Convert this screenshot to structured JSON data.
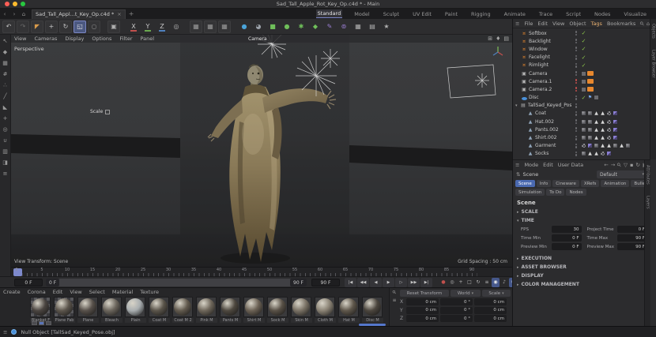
{
  "window": {
    "title": "Sad_Tall_Apple_Rot_Key_Op.c4d * - Main"
  },
  "nav": {
    "back": "‹",
    "forward": "›",
    "home": "⌂",
    "tab_label": "Sad_Tall_Appl...t_Key_Op.c4d *",
    "tab_close": "×",
    "tab_add": "+"
  },
  "layouts": {
    "active": "Standard",
    "items": [
      "Standard",
      "Model",
      "Sculpt",
      "UV Edit",
      "Paint",
      "Rigging",
      "Animate",
      "Trace",
      "Script",
      "Nodes",
      "Visualize"
    ]
  },
  "toolbar": {
    "icons": [
      {
        "name": "undo-icon",
        "glyph": "↶",
        "color": "#c0c0c0"
      },
      {
        "name": "redo-icon",
        "glyph": "↷",
        "color": "#6a6a6a"
      },
      {
        "name": "live-selection-icon",
        "glyph": "◤",
        "color": "#d89a4a"
      },
      {
        "name": "move-tool-icon",
        "glyph": "+",
        "color": "#c8c8c8"
      },
      {
        "name": "rotate-tool-icon",
        "glyph": "↻",
        "color": "#c8c8c8"
      },
      {
        "name": "scale-tool-icon",
        "glyph": "◱",
        "color": "#e8e8e8",
        "active": true
      },
      {
        "name": "last-tool-icon",
        "glyph": "○",
        "color": "#8a8a8a"
      },
      {
        "name": "sep",
        "sep": true
      },
      {
        "name": "workplane-icon",
        "glyph": "▣",
        "color": "#b0b0b0"
      },
      {
        "name": "sep",
        "sep": true
      },
      {
        "name": "x-axis-lock",
        "glyph": "X",
        "color": "#c8c8c8",
        "underline": "#c0504d",
        "noboxed": true
      },
      {
        "name": "y-axis-lock",
        "glyph": "Y",
        "color": "#c8c8c8",
        "underline": "#6aa84f",
        "noboxed": true
      },
      {
        "name": "z-axis-lock",
        "glyph": "Z",
        "color": "#c8c8c8",
        "underline": "#4f81bd",
        "noboxed": true
      },
      {
        "name": "coord-system-icon",
        "glyph": "◎",
        "color": "#b0b0b0",
        "noboxed": true
      },
      {
        "name": "sep",
        "sep": true
      },
      {
        "name": "keyframe-bar-1-icon",
        "glyph": "▦",
        "color": "#9a9a9a"
      },
      {
        "name": "keyframe-bar-2-icon",
        "glyph": "▦",
        "color": "#9a9a9a"
      },
      {
        "name": "keyframe-bar-3-icon",
        "glyph": "▦",
        "color": "#9a9a9a"
      },
      {
        "name": "sep",
        "sep": true
      },
      {
        "name": "render-view-icon",
        "glyph": "●",
        "color": "#4aa3d8",
        "noboxed": true
      },
      {
        "name": "render-settings-icon",
        "glyph": "◕",
        "color": "#9aa0a8",
        "noboxed": true
      },
      {
        "name": "add-cube-icon",
        "glyph": "■",
        "color": "#6fbf5a",
        "noboxed": true
      },
      {
        "name": "add-sphere-icon",
        "glyph": "●",
        "color": "#6fbf5a",
        "noboxed": true
      },
      {
        "name": "generators-icon",
        "glyph": "✱",
        "color": "#6fbf5a",
        "noboxed": true
      },
      {
        "name": "deformers-icon",
        "glyph": "◆",
        "color": "#6fbf5a",
        "noboxed": true
      },
      {
        "name": "spline-pen-icon",
        "glyph": "✎",
        "color": "#9b7fd4",
        "noboxed": true
      },
      {
        "name": "mograph-icon",
        "glyph": "⊚",
        "color": "#9b7fd4",
        "noboxed": true
      },
      {
        "name": "array-icon",
        "glyph": "▦",
        "color": "#b0b0b0",
        "noboxed": true
      },
      {
        "name": "folder-icon",
        "glyph": "▤",
        "color": "#b0b0b0",
        "noboxed": true
      },
      {
        "name": "magic-icon",
        "glyph": "★",
        "color": "#b0b0b0",
        "noboxed": true
      }
    ]
  },
  "left_palette": {
    "icons": [
      {
        "name": "make-editable-icon",
        "glyph": "↖"
      },
      {
        "name": "model-mode-icon",
        "glyph": "◆"
      },
      {
        "name": "texture-mode-icon",
        "glyph": "▦"
      },
      {
        "name": "workplane-mode-icon",
        "glyph": "#"
      },
      {
        "name": "points-mode-icon",
        "glyph": "∴"
      },
      {
        "name": "edges-mode-icon",
        "glyph": "╱"
      },
      {
        "name": "polygons-mode-icon",
        "glyph": "◣"
      },
      {
        "name": "tweak-mode-icon",
        "glyph": "+"
      },
      {
        "name": "axis-mode-icon",
        "glyph": "◎"
      },
      {
        "name": "snap-icon",
        "glyph": "∪"
      },
      {
        "name": "quantize-icon",
        "glyph": "▥"
      },
      {
        "name": "workplane-lock-icon",
        "glyph": "◨"
      },
      {
        "name": "filter-list-icon",
        "glyph": "≡"
      }
    ]
  },
  "viewport": {
    "menus": [
      "View",
      "Cameras",
      "Display",
      "Options",
      "Filter",
      "Panel"
    ],
    "view_label": "Perspective",
    "camera_label": "Camera",
    "hud_scale_label": "Scale",
    "transform_label": "View Transform: Scene",
    "grid_label": "Grid Spacing : 50 cm",
    "corner_icons": [
      {
        "name": "grid-toggle-icon",
        "glyph": "⊞"
      },
      {
        "name": "render-safe-icon",
        "glyph": "♦"
      },
      {
        "name": "view-layout-icon",
        "glyph": "▤"
      }
    ]
  },
  "object_manager": {
    "menus": [
      "File",
      "Edit",
      "View",
      "Object",
      "Tags",
      "Bookmarks"
    ],
    "active_menu": "Tags",
    "header_icons": [
      {
        "name": "search-icon",
        "glyph": "⚲"
      },
      {
        "name": "home-icon",
        "glyph": "⌂"
      },
      {
        "name": "filter-icon",
        "glyph": "▽"
      },
      {
        "name": "new-panel-icon",
        "glyph": "▣"
      }
    ],
    "objects": [
      {
        "name": "Softbox",
        "icon": "light",
        "dots": "gray",
        "tags": [
          "check"
        ]
      },
      {
        "name": "Backlight",
        "icon": "light",
        "dots": "gray",
        "tags": [
          "check"
        ]
      },
      {
        "name": "Window",
        "icon": "light",
        "dots": "gray",
        "tags": [
          "check"
        ]
      },
      {
        "name": "Facelight",
        "icon": "light",
        "dots": "gray",
        "tags": [
          "check"
        ]
      },
      {
        "name": "Rimlight",
        "icon": "light",
        "dots": "gray",
        "tags": [
          "check"
        ]
      },
      {
        "name": "Camera",
        "icon": "camera",
        "dots": "gray",
        "tags": [
          "comp",
          "cam"
        ]
      },
      {
        "name": "Camera.1",
        "icon": "camera",
        "dots": "red",
        "tags": [
          "comp",
          "cam"
        ]
      },
      {
        "name": "Camera.2",
        "icon": "camera",
        "dots": "red",
        "tags": [
          "comp",
          "cam"
        ]
      },
      {
        "name": "Disc",
        "icon": "disc",
        "dots": "gray",
        "tags": [
          "check",
          "display",
          "comp"
        ]
      },
      {
        "name": "TallSad_Keyed_Pose.obj",
        "icon": "file",
        "dots": "gray",
        "caret": "▾",
        "tags": []
      },
      {
        "name": "Coat",
        "icon": "mesh",
        "dots": "gray",
        "indent": true,
        "tags": [
          "tex",
          "tex",
          "phong",
          "phong",
          "uvw",
          "sim"
        ]
      },
      {
        "name": "Hat.002",
        "icon": "mesh",
        "dots": "gray",
        "indent": true,
        "tags": [
          "tex",
          "tex",
          "phong",
          "phong",
          "uvw",
          "sim"
        ]
      },
      {
        "name": "Pants.002",
        "icon": "mesh",
        "dots": "gray",
        "indent": true,
        "tags": [
          "tex",
          "tex",
          "phong",
          "phong",
          "uvw",
          "sim"
        ]
      },
      {
        "name": "Shirt.002",
        "icon": "mesh",
        "dots": "gray",
        "indent": true,
        "tags": [
          "tex",
          "tex",
          "phong",
          "phong",
          "uvw",
          "sim"
        ]
      },
      {
        "name": "Garment",
        "icon": "mesh",
        "dots": "gray",
        "indent": true,
        "tags": [
          "uvw",
          "sim",
          "tex",
          "phong",
          "phong",
          "tex",
          "phong",
          "tex"
        ]
      },
      {
        "name": "Socks",
        "icon": "mesh",
        "dots": "gray",
        "indent": true,
        "tags": [
          "tex",
          "phong",
          "phong",
          "uvw",
          "sim"
        ]
      }
    ]
  },
  "side_tabs": {
    "top": [
      "Objects",
      "Layer Browser"
    ],
    "bottom": [
      "Attributes",
      "Layers"
    ]
  },
  "attributes": {
    "menus": [
      "Mode",
      "Edit",
      "User Data"
    ],
    "header_icons": [
      {
        "name": "back-icon",
        "glyph": "←"
      },
      {
        "name": "forward-icon",
        "glyph": "→"
      },
      {
        "name": "search-icon",
        "glyph": "⚲"
      },
      {
        "name": "filter-icon",
        "glyph": "▽"
      },
      {
        "name": "lock-icon",
        "glyph": "▪"
      },
      {
        "name": "history-icon",
        "glyph": "↻"
      },
      {
        "name": "new-panel-icon",
        "glyph": "▣"
      }
    ],
    "object_icon": "⇅",
    "object_label": "Scene",
    "preset_dropdown": "Default",
    "tabs_row1": [
      "Scene",
      "Info",
      "Cineware",
      "XRefs",
      "Animation",
      "Bullet"
    ],
    "tabs_row2": [
      "Simulation",
      "To Do",
      "Nodes"
    ],
    "active_tab": "Scene",
    "title": "Scene",
    "collapsed_caret": "▸",
    "expanded_caret": "▾",
    "sections": [
      {
        "label": "SCALE",
        "expanded": false
      },
      {
        "label": "TIME",
        "expanded": true
      },
      {
        "label": "EXECUTION",
        "expanded": false
      },
      {
        "label": "ASSET BROWSER",
        "expanded": false
      },
      {
        "label": "DISPLAY",
        "expanded": false
      },
      {
        "label": "COLOR MANAGEMENT",
        "expanded": false
      }
    ],
    "time_fields": [
      {
        "l1": "FPS",
        "v1": "30",
        "l2": "Project Time",
        "v2": "0 F"
      },
      {
        "l1": "Time Min",
        "v1": "0 F",
        "l2": "Time Max",
        "v2": "90 F"
      },
      {
        "l1": "Preview Min",
        "v1": "0 F",
        "l2": "Preview Max",
        "v2": "90 F"
      }
    ]
  },
  "timeline": {
    "tick_labels": [
      "0",
      "5",
      "10",
      "15",
      "20",
      "25",
      "30",
      "35",
      "40",
      "45",
      "50",
      "55",
      "60",
      "65",
      "70",
      "75",
      "80",
      "85",
      "90"
    ],
    "current_frame": "0 F",
    "range_start": "0 F",
    "range_end": "90 F",
    "end_frame": "90 F",
    "transport": [
      {
        "name": "goto-start-button",
        "glyph": "|◀"
      },
      {
        "name": "prev-key-button",
        "glyph": "◀◀"
      },
      {
        "name": "prev-frame-button",
        "glyph": "◀"
      },
      {
        "name": "play-button",
        "glyph": "▶"
      },
      {
        "name": "next-frame-button",
        "glyph": "▷"
      },
      {
        "name": "next-key-button",
        "glyph": "▶▶"
      },
      {
        "name": "goto-end-button",
        "glyph": "▶|"
      }
    ],
    "key_buttons": [
      {
        "name": "record-button",
        "glyph": "●",
        "color": "#c0504d"
      },
      {
        "name": "keyframe-selection-button",
        "glyph": "◎"
      },
      {
        "name": "key-position-button",
        "glyph": "+"
      },
      {
        "name": "key-scale-button",
        "glyph": "□"
      },
      {
        "name": "key-rotation-button",
        "glyph": "↻"
      },
      {
        "name": "key-parameter-button",
        "glyph": "≡"
      },
      {
        "name": "autokey-button",
        "glyph": "◉",
        "active": true
      },
      {
        "name": "sound-button",
        "glyph": "♪"
      },
      {
        "name": "snap-button",
        "glyph": "∪",
        "active": true
      }
    ]
  },
  "materials": {
    "menus": [
      "Create",
      "Corona",
      "Edit",
      "View",
      "Select",
      "Material",
      "Texture"
    ],
    "items": [
      {
        "name": "Blanket F",
        "color": "#4a4440",
        "checker": true
      },
      {
        "name": "Plane Fab",
        "color": "#5c554c",
        "checker": true
      },
      {
        "name": "Plane",
        "color": "#57504a"
      },
      {
        "name": "Bleach",
        "color": "#6b655c"
      },
      {
        "name": "Plain",
        "color": "#a8adaf"
      },
      {
        "name": "Coat M",
        "color": "#5a544a"
      },
      {
        "name": "Coat M 2",
        "color": "#625a4e"
      },
      {
        "name": "Pink M",
        "color": "#6e665a"
      },
      {
        "name": "Pants M",
        "color": "#4e483f"
      },
      {
        "name": "Shirt M",
        "color": "#6b6154"
      },
      {
        "name": "Sock M",
        "color": "#585046"
      },
      {
        "name": "Skin M",
        "color": "#7a7265"
      },
      {
        "name": "Cloth M",
        "color": "#8a8274"
      },
      {
        "name": "Hat M",
        "color": "#5f574b"
      },
      {
        "name": "Disc M",
        "color": "#4c463e"
      }
    ]
  },
  "coords": {
    "search_icon": "⚲",
    "menu_icon": "≡",
    "reset_label": "Reset Transform",
    "space_dropdown": "World",
    "mode_dropdown": "Scale",
    "rows": [
      {
        "axis": "X",
        "pos": "0 cm",
        "rot": "0 °",
        "scale": "0 cm"
      },
      {
        "axis": "Y",
        "pos": "0 cm",
        "rot": "0 °",
        "scale": "0 cm"
      },
      {
        "axis": "Z",
        "pos": "0 cm",
        "rot": "0 °",
        "scale": "0 cm"
      }
    ]
  },
  "statusbar": {
    "menu_icon": "≡",
    "text": "Null Object [TallSad_Keyed_Pose.obj]"
  }
}
